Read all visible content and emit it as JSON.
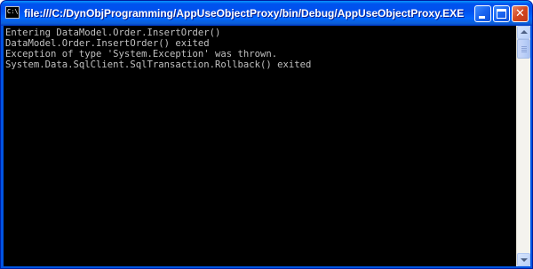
{
  "window": {
    "title": "file:///C:/DynObjProgramming/AppUseObjectProxy/bin/Debug/AppUseObjectProxy.EXE",
    "icon": "console-window-icon",
    "icon_glyph": "C:\\",
    "buttons": {
      "minimize": "minimize-icon",
      "maximize": "maximize-icon",
      "close": "close-icon",
      "close_glyph": "✕"
    }
  },
  "console": {
    "lines": [
      "Entering DataModel.Order.InsertOrder()",
      "DataModel.Order.InsertOrder() exited",
      "Exception of type 'System.Exception' was thrown.",
      "System.Data.SqlClient.SqlTransaction.Rollback() exited"
    ],
    "foreground": "#c0c0c0",
    "background": "#000000"
  },
  "scrollbar": {
    "up_icon": "arrow-up-icon",
    "down_icon": "arrow-down-icon"
  },
  "colors": {
    "titlebar": "#0058ee",
    "frame": "#0054e3",
    "close_button": "#d2461e"
  }
}
